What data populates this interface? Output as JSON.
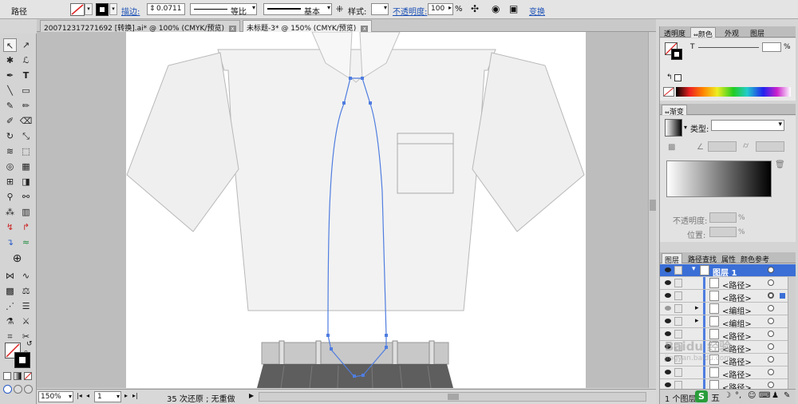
{
  "control_bar": {
    "object_type": "路径",
    "stroke_label": "描边:",
    "stroke_width": "0.0711",
    "profile_label": "等比",
    "brush_label": "基本",
    "style_label": "样式:",
    "opacity_label": "不透明度:",
    "opacity_value": "100",
    "percent": "%",
    "transform_label": "变换"
  },
  "tabs": [
    {
      "label": "200712317271692 [转换].ai* @ 100% (CMYK/预览)"
    },
    {
      "label": "未标题-3* @ 150% (CMYK/预览)"
    }
  ],
  "status": {
    "zoom": "150%",
    "page": "1",
    "undo": "35 次还原 ; 无重做"
  },
  "color_panel": {
    "tabs": [
      "透明度",
      "颜色",
      "外观",
      "图层"
    ],
    "t_label": "T",
    "percent": "%"
  },
  "gradient_panel": {
    "tab": "渐变",
    "type_label": "类型:",
    "opacity_label": "不透明度:",
    "location_label": "位置:"
  },
  "layers_panel": {
    "tabs": [
      "图层",
      "路径查找",
      "属性",
      "颜色参考"
    ],
    "layer_name": "图层 1",
    "rows": [
      "<路径>",
      "<路径>",
      "<编组>",
      "<编组>",
      "<路径>",
      "<路径>",
      "<路径>",
      "<路径>",
      "<路径>"
    ],
    "footer": "1 个图层"
  },
  "watermark": {
    "text": "Baidu 经验",
    "url": "jingyan.baidu.com"
  },
  "taskbar": {
    "ime": "五"
  },
  "colors": {
    "path_selection": "#4f7de0",
    "shirt_fill": "#f2f2f2",
    "shirt_stroke": "#b8b8b8",
    "belt_fill": "#c8c8c8",
    "pants_fill": "#5e5e5e"
  }
}
